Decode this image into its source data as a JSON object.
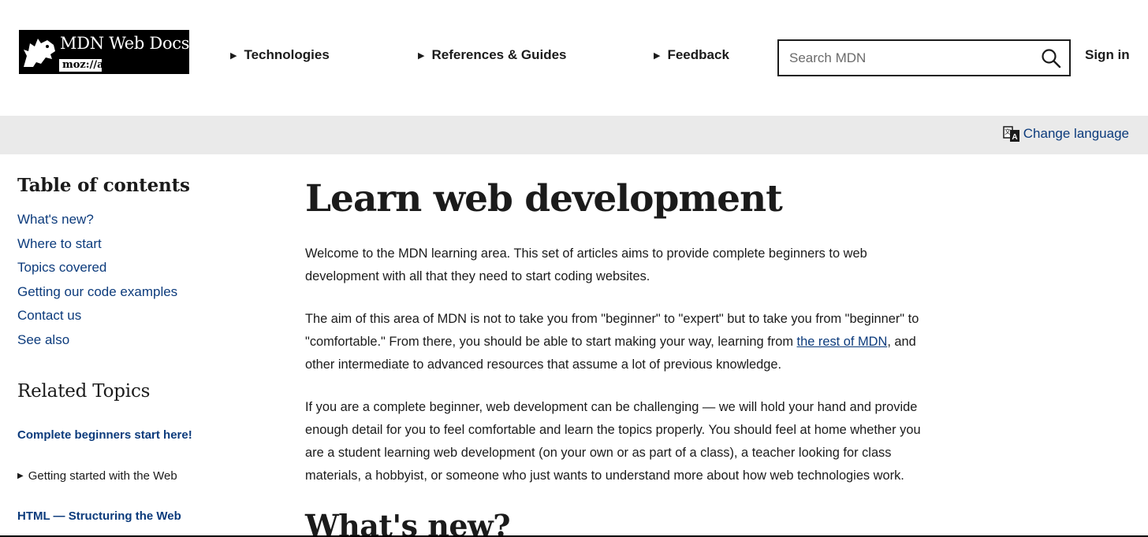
{
  "header": {
    "logo": {
      "brand": "MDN Web Docs",
      "sub": "moz://a",
      "icon": "dinosaur-icon"
    },
    "nav": [
      {
        "label": "Technologies"
      },
      {
        "label": "References & Guides"
      },
      {
        "label": "Feedback"
      }
    ],
    "search": {
      "placeholder": "Search MDN",
      "icon": "search-icon"
    },
    "signin": "Sign in"
  },
  "langbar": {
    "change_language": "Change language",
    "icon": "translate-icon"
  },
  "sidebar": {
    "toc_title": "Table of contents",
    "toc": [
      "What's new?",
      "Where to start",
      "Topics covered",
      "Getting our code examples",
      "Contact us",
      "See also"
    ],
    "related_title": "Related Topics",
    "related_top": "Complete beginners start here!",
    "related_detail": "Getting started with the Web",
    "related_bottom": "HTML — Structuring the Web"
  },
  "main": {
    "title": "Learn web development",
    "p1": "Welcome to the MDN learning area. This set of articles aims to provide complete beginners to web development with all that they need to start coding websites.",
    "p2_before": "The aim of this area of MDN is not to take you from \"beginner\" to \"expert\" but to take you from \"beginner\" to \"comfortable.\" From there, you should be able to start making your way, learning from ",
    "p2_link": "the rest of MDN",
    "p2_after": ", and other intermediate to advanced resources that assume a lot of previous knowledge.",
    "p3": "If you are a complete beginner, web development can be challenging — we will hold your hand and provide enough detail for you to feel comfortable and learn the topics properly. You should feel at home whether you are a student learning web development (on your own or as part of a class), a teacher looking for class materials, a hobbyist, or someone who just wants to understand more about how web technologies work.",
    "h2": "What's new?"
  },
  "colors": {
    "link": "#0c3b7c",
    "text": "#1b1b1b",
    "langbar": "#eaeaea"
  }
}
